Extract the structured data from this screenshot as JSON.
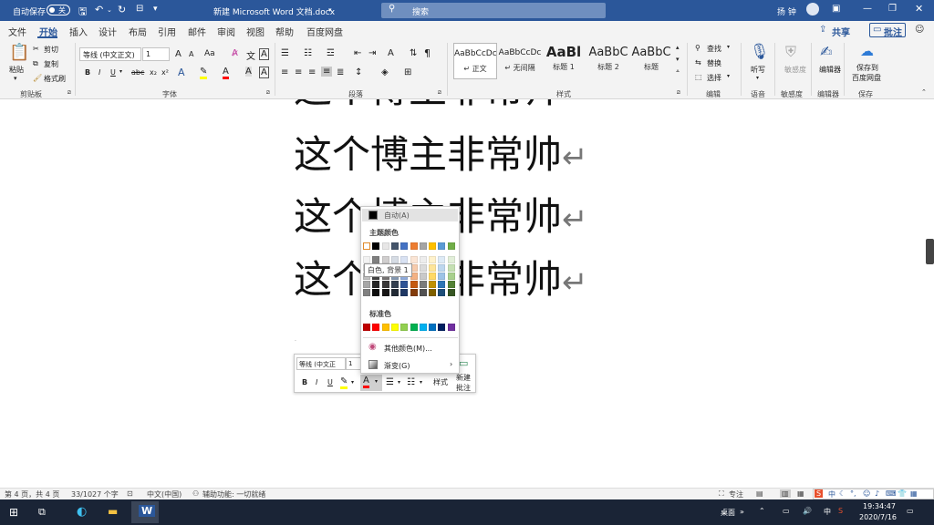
{
  "titlebar": {
    "autosave_label": "自动保存",
    "autosave_state": "关",
    "doc_title": "新建 Microsoft Word 文档.docx",
    "search_placeholder": "搜索",
    "user_name": "扬 钟",
    "accent": "#2b579a"
  },
  "tabs": [
    "文件",
    "开始",
    "插入",
    "设计",
    "布局",
    "引用",
    "邮件",
    "审阅",
    "视图",
    "帮助",
    "百度网盘"
  ],
  "active_tab": "开始",
  "share": {
    "share_label": "共享",
    "comment_label": "批注"
  },
  "ribbon": {
    "clipboard": {
      "paste": "粘贴",
      "cut": "剪切",
      "copy": "复制",
      "format_painter": "格式刷",
      "group": "剪贴板"
    },
    "font": {
      "font_name": "等线 (中文正文)",
      "font_size": "1",
      "grow": "A",
      "shrink": "A",
      "aa": "Aa",
      "bold": "B",
      "italic": "I",
      "underline": "U",
      "strike": "abc",
      "sub": "x₂",
      "sup": "x²",
      "group": "字体"
    },
    "paragraph": {
      "group": "段落"
    },
    "styles": {
      "items": [
        {
          "preview": "AaBbCcDc",
          "name": "↵ 正文"
        },
        {
          "preview": "AaBbCcDc",
          "name": "↵ 无间隔"
        },
        {
          "preview": "AaBl",
          "name": "标题 1"
        },
        {
          "preview": "AaBbC",
          "name": "标题 2"
        },
        {
          "preview": "AaBbC",
          "name": "标题"
        }
      ],
      "group": "样式"
    },
    "editing": {
      "find": "查找",
      "replace": "替换",
      "select": "选择",
      "group": "编辑"
    },
    "voice": {
      "dictate": "听写",
      "group": "语音"
    },
    "sensitivity": {
      "label": "敏感度",
      "btn": "敏感度",
      "group": "敏感度"
    },
    "editor": {
      "label": "编辑器",
      "group": "编辑器"
    },
    "save": {
      "label_line1": "保存到",
      "label_line2": "百度网盘",
      "group": "保存"
    }
  },
  "document": {
    "lines": [
      "这个博主非常帅",
      "这个博主非常帅",
      "这个博主非常帅",
      "这个博主非常帅"
    ],
    "return_mark": "↵"
  },
  "minibar": {
    "font_name": "等线 (中文正",
    "font_size": "1",
    "bold": "B",
    "italic": "I",
    "underline": "U",
    "styles_label": "样式",
    "new_comment_line1": "新建",
    "new_comment_line2": "批注"
  },
  "color_popup": {
    "auto_label": "自动(A)",
    "theme_label": "主题颜色",
    "tooltip": "白色, 背景 1",
    "standard_label": "标准色",
    "more_colors": "其他颜色(M)...",
    "gradient": "渐变(G)",
    "theme_colors": [
      "#ffffff",
      "#000000",
      "#e7e6e6",
      "#44546a",
      "#4472c4",
      "#ed7d31",
      "#a5a5a5",
      "#ffc000",
      "#5b9bd5",
      "#70ad47"
    ],
    "shade_columns": [
      [
        "#f2f2f2",
        "#d9d9d9",
        "#bfbfbf",
        "#a6a6a6",
        "#808080"
      ],
      [
        "#7f7f7f",
        "#595959",
        "#404040",
        "#262626",
        "#0d0d0d"
      ],
      [
        "#d0cece",
        "#aeabab",
        "#757171",
        "#3a3838",
        "#171616"
      ],
      [
        "#d6dce4",
        "#adb9ca",
        "#8497b0",
        "#333f4f",
        "#222a35"
      ],
      [
        "#d9e2f3",
        "#b4c6e7",
        "#8eaadb",
        "#2f5496",
        "#1f3864"
      ],
      [
        "#fbe5d5",
        "#f7cbac",
        "#f4b183",
        "#c55a11",
        "#833c0b"
      ],
      [
        "#ededed",
        "#dbdbdb",
        "#c9c9c9",
        "#7b7b7b",
        "#525252"
      ],
      [
        "#fff2cc",
        "#fee599",
        "#ffd965",
        "#bf9000",
        "#7f6000"
      ],
      [
        "#deebf6",
        "#bdd7ee",
        "#9dc3e6",
        "#2e75b5",
        "#1e4e79"
      ],
      [
        "#e2efd9",
        "#c5e0b3",
        "#a8d08d",
        "#538135",
        "#375623"
      ]
    ],
    "standard_colors": [
      "#c00000",
      "#ff0000",
      "#ffc000",
      "#ffff00",
      "#92d050",
      "#00b050",
      "#00b0f0",
      "#0070c0",
      "#002060",
      "#7030a0"
    ]
  },
  "statusbar": {
    "page": "第 4 页，共 4 页",
    "words": "33/1027 个字",
    "lang": "中文(中国)",
    "accessibility": "辅助功能: 一切就绪",
    "focus": "专注"
  },
  "taskbar": {
    "desktop": "桌面",
    "ime": "中",
    "time": "19:34:47",
    "date": "2020/7/16"
  }
}
